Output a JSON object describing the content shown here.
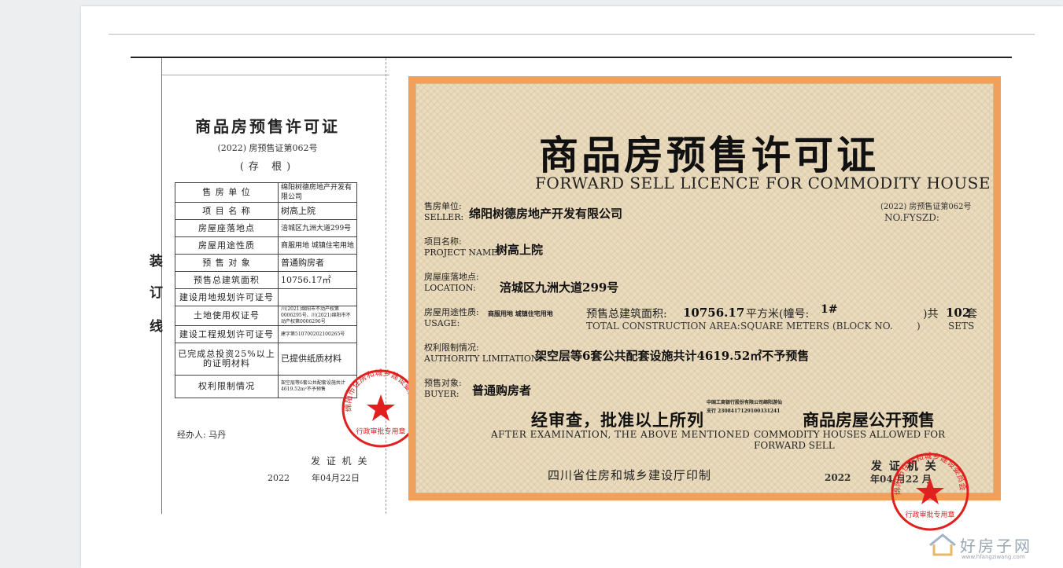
{
  "stub": {
    "binding": [
      "装",
      "订",
      "线"
    ],
    "title": "商品房预售许可证",
    "permit_no": "(2022) 房预售证第062号",
    "copy_label": "(存 根)",
    "rows": [
      {
        "label": "售 房 单 位",
        "value": "绵阳树德房地产开发有限公司",
        "cls": "v"
      },
      {
        "label": "项 目 名 称",
        "value": "树高上院",
        "cls": "v big"
      },
      {
        "label": "房屋座落地点",
        "value": "涪城区九洲大道299号",
        "cls": "v"
      },
      {
        "label": "房屋用途性质",
        "value": "商服用地 城镇住宅用地",
        "cls": "v"
      },
      {
        "label": "预 售 对 象",
        "value": "普通购房者",
        "cls": "v big"
      },
      {
        "label": "预售总建筑面积",
        "value": "10756.17㎡",
        "cls": "v big"
      },
      {
        "label": "建设用地规划许可证号",
        "value": "",
        "cls": "v"
      },
      {
        "label": "土地使用权证号",
        "value": "川(2021)绵阳市不动产权第0006295号、川(2021)绵阳市不动产权第0006296号",
        "cls": "v tiny"
      },
      {
        "label": "建设工程规划许可证号",
        "value": "建字第510700202100265号",
        "cls": "v tiny"
      },
      {
        "label": "已完成总投资25%以上的证明材料",
        "value": "已提供纸质材料",
        "cls": "v big"
      },
      {
        "label": "权利限制情况",
        "value": "架空层等6套公共配套设施共计4619.52m²不予预售",
        "cls": "v tiny"
      }
    ],
    "handler": "经办人: 马丹",
    "issuer": "发 证 机 关",
    "year": "2022",
    "date": "年04月22日"
  },
  "cert": {
    "title": "商品房预售许可证",
    "subtitle": "FORWARD SELL LICENCE FOR COMMODITY HOUSE",
    "permit_no": "(2022) 房预售证第062号",
    "permit_no_en": "NO.FYSZD:",
    "seller_label_cn": "售房单位:",
    "seller_label_en": "SELLER:",
    "seller": "绵阳树德房地产开发有限公司",
    "project_label_cn": "项目名称:",
    "project_label_en": "PROJECT NAME:",
    "project": "树高上院",
    "location_label_cn": "房屋座落地点:",
    "location_label_en": "LOCATION:",
    "location": "涪城区九洲大道299号",
    "usage_label_cn": "房屋用途性质:",
    "usage_label_en": "USAGE:",
    "usage": "商服用地 城镇住宅用地",
    "area_label": "预售总建筑面积:",
    "area": "10756.17",
    "area_unit": "平方米(幢号:",
    "block": "1#",
    "sets_label": ")共",
    "sets": "102",
    "sets_unit": "套",
    "area_en": "TOTAL CONSTRUCTION AREA:",
    "sqm_en": "SQUARE METERS (BLOCK NO.",
    "close_paren": ")",
    "sets_en": "SETS",
    "authority_label_cn": "权利限制情况:",
    "authority_label_en": "AUTHORITY LIMITATION:",
    "authority": "架空层等6套公共配套设施共计4619.52㎡不予预售",
    "buyer_label_cn": "预售对象:",
    "buyer_label_en": "BUYER:",
    "buyer": "普通购房者",
    "approve": "经审查，批准以上所列",
    "bank_line1": "中国工商银行股份有限公司绵阳游仙",
    "bank_line2": "支行    2308417129100331241",
    "approve2": "商品房屋公开预售",
    "after_en": "AFTER EXAMINATION, THE ABOVE MENTIONED",
    "after_en2": "COMMODITY HOUSES ALLOWED FOR FORWARD SELL",
    "printer": "四川省住房和城乡建设厅印制",
    "issuer": "发 证 机 关",
    "year": "2022",
    "date": "年04 月22 月"
  },
  "seal": {
    "text": "绵阳市住房和城乡建设委员会",
    "bottom": "行政审批专用章",
    "color": "#e0201e"
  },
  "watermark": {
    "name": "好房子网",
    "url": "www.hfangziwang.com"
  }
}
